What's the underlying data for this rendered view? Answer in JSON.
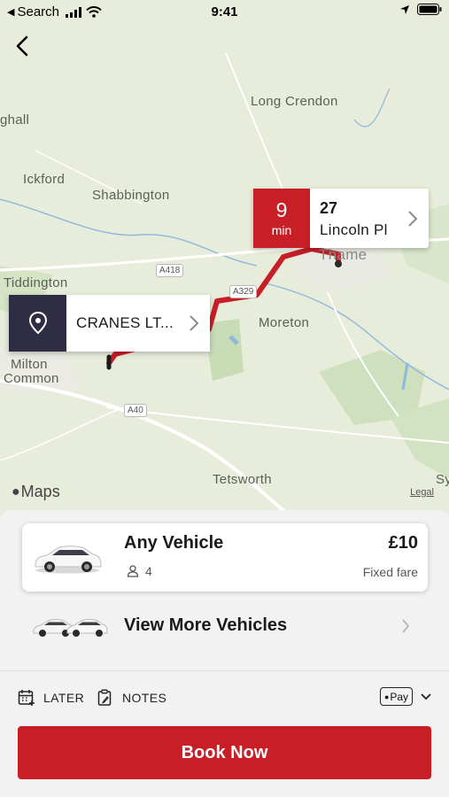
{
  "status_bar": {
    "back_app": "Search",
    "time": "9:41"
  },
  "map": {
    "places": {
      "long_crendon": "Long Crendon",
      "ghall": "ghall",
      "ickford": "Ickford",
      "shabbington": "Shabbington",
      "tiddington": "Tiddington",
      "thame": "Thame",
      "moreton": "Moreton",
      "milton": "Milton",
      "common": "Common",
      "tetsworth": "Tetsworth",
      "sy": "Sy"
    },
    "roads": {
      "a418": "A418",
      "a329": "A329",
      "a40": "A40"
    },
    "pickup": {
      "label": "CRANES LT..."
    },
    "destination": {
      "eta_number": "9",
      "eta_unit": "min",
      "number": "27",
      "street": "Lincoln Pl"
    },
    "attribution": "Maps",
    "legal": "Legal",
    "route_color": "#c81e26"
  },
  "vehicle": {
    "name": "Any Vehicle",
    "seats": "4",
    "price": "£10",
    "fare_type": "Fixed fare"
  },
  "more_vehicles": {
    "label": "View More Vehicles"
  },
  "options": {
    "later": "LATER",
    "notes": "NOTES",
    "payment": "Pay"
  },
  "book_button": {
    "label": "Book Now",
    "color": "#c81e26"
  }
}
